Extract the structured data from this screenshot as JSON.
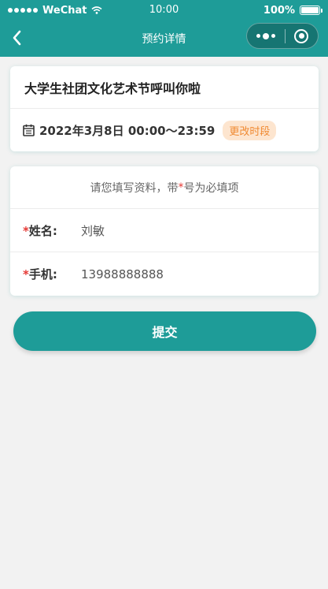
{
  "status_bar": {
    "carrier": "WeChat",
    "time": "10:00",
    "battery": "100%"
  },
  "nav": {
    "title": "预约详情",
    "back_icon": "chevron-left-icon",
    "more_icon": "more-dots-icon",
    "close_icon": "close-circle-icon"
  },
  "event": {
    "title": "大学生社团文化艺术节呼叫你啦",
    "datetime": "2022年3月8日 00:00～23:59",
    "change_label": "更改时段",
    "calendar_icon": "calendar-icon"
  },
  "form": {
    "hint_prefix": "请您填写资料，带",
    "hint_star": "*",
    "hint_suffix": "号为必填项",
    "fields": [
      {
        "label": "姓名:",
        "value": "刘敏"
      },
      {
        "label": "手机:",
        "value": "13988888888"
      }
    ],
    "required_mark": "*"
  },
  "submit_label": "提交",
  "colors": {
    "primary": "#1e9c98",
    "required": "#e53935",
    "badge_bg": "#fde5cf",
    "badge_text": "#f08a32"
  }
}
